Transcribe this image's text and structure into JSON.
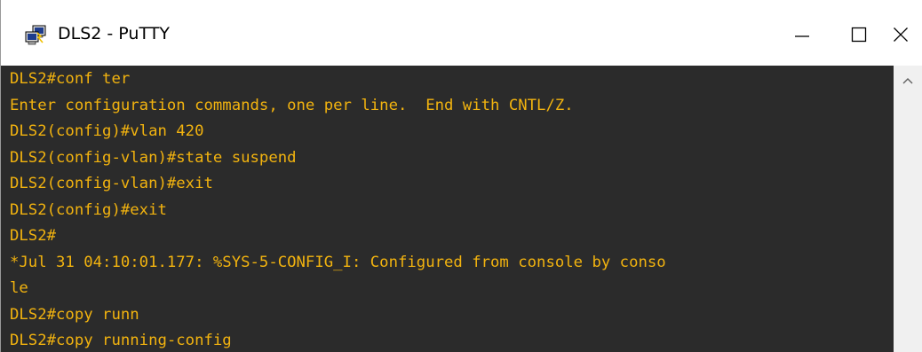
{
  "window": {
    "title": "DLS2 - PuTTY",
    "icons": {
      "app": "putty-icon",
      "minimize": "minimize-icon",
      "maximize": "maximize-icon",
      "close": "close-icon",
      "scroll_up": "scroll-up-icon"
    }
  },
  "colors": {
    "terminal_bg": "#2b2b2b",
    "terminal_text": "#f2b30f"
  },
  "terminal": {
    "lines": [
      "DLS2#conf ter",
      "Enter configuration commands, one per line.  End with CNTL/Z.",
      "DLS2(config)#vlan 420",
      "DLS2(config-vlan)#state suspend",
      "DLS2(config-vlan)#exit",
      "DLS2(config)#exit",
      "DLS2#",
      "*Jul 31 04:10:01.177: %SYS-5-CONFIG_I: Configured from console by conso",
      "le",
      "DLS2#copy runn",
      "DLS2#copy running-config"
    ]
  }
}
